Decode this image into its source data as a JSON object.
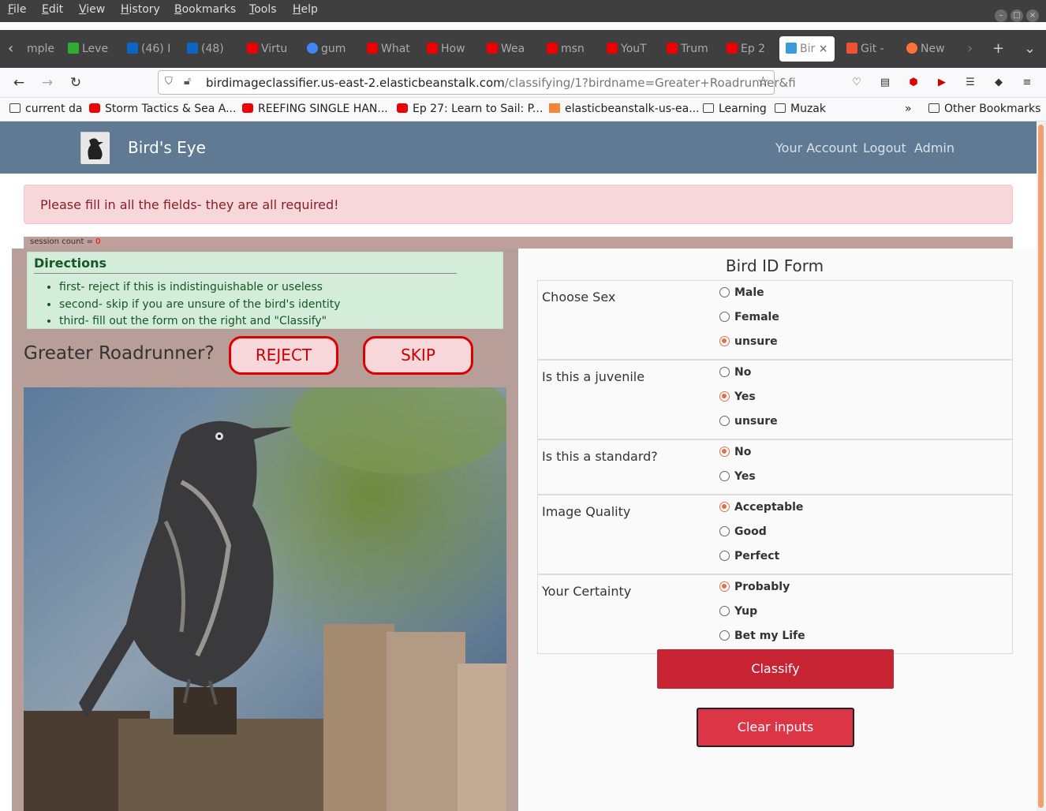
{
  "browser": {
    "menu": [
      "File",
      "Edit",
      "View",
      "History",
      "Bookmarks",
      "Tools",
      "Help"
    ],
    "tabs": [
      {
        "label": "mple",
        "icon": "none"
      },
      {
        "label": "Leve",
        "icon": "leaf-icon"
      },
      {
        "label": "(46) I",
        "icon": "linkedin-icon"
      },
      {
        "label": "(48)",
        "icon": "linkedin-icon"
      },
      {
        "label": "Virtu",
        "icon": "youtube-icon"
      },
      {
        "label": "gum",
        "icon": "google-icon"
      },
      {
        "label": "What",
        "icon": "youtube-icon"
      },
      {
        "label": "How",
        "icon": "youtube-icon"
      },
      {
        "label": "Wea",
        "icon": "youtube-icon"
      },
      {
        "label": "msn",
        "icon": "youtube-icon"
      },
      {
        "label": "YouT",
        "icon": "youtube-icon"
      },
      {
        "label": "Trum",
        "icon": "youtube-icon"
      },
      {
        "label": "Ep 2",
        "icon": "youtube-icon"
      },
      {
        "label": "Bir",
        "icon": "bird-icon",
        "active": true
      },
      {
        "label": "Git -",
        "icon": "git-icon"
      },
      {
        "label": "New",
        "icon": "firefox-icon"
      }
    ],
    "url": {
      "host": "birdimageclassifier.us-east-2.elasticbeanstalk.com",
      "path": "/classifying/1?birdname=Greater+Roadrunner&fi"
    },
    "bookmarks": [
      {
        "label": "current da",
        "icon": "folder"
      },
      {
        "label": "Storm Tactics & Sea A...",
        "icon": "yt"
      },
      {
        "label": "REEFING SINGLE HAN...",
        "icon": "yt"
      },
      {
        "label": "Ep 27: Learn to Sail: P...",
        "icon": "yt"
      },
      {
        "label": "elasticbeanstalk-us-ea...",
        "icon": "aws"
      },
      {
        "label": "Learning",
        "icon": "folder"
      },
      {
        "label": "Muzak",
        "icon": "folder"
      }
    ],
    "other_bookmarks": "Other Bookmarks"
  },
  "site": {
    "brand": "Bird's Eye",
    "nav": [
      "Your Account",
      "Logout",
      "Admin"
    ]
  },
  "alert": "Please fill in all the fields- they are all required!",
  "session": {
    "label": "session count = ",
    "count": "0"
  },
  "directions": {
    "title": "Directions",
    "items": [
      "first- reject if this is indistinguishable or useless",
      "second- skip if you are unsure of the bird's identity",
      "third- fill out the form on the right and \"Classify\""
    ]
  },
  "species_question": "Greater Roadrunner?",
  "buttons": {
    "reject": "REJECT",
    "skip": "SKIP",
    "classify": "Classify",
    "clear": "Clear inputs"
  },
  "form": {
    "title": "Bird ID Form",
    "fields": [
      {
        "label": "Choose Sex",
        "options": [
          "Male",
          "Female",
          "unsure"
        ],
        "selected": 2
      },
      {
        "label": "Is this a juvenile",
        "options": [
          "No",
          "Yes",
          "unsure"
        ],
        "selected": 1
      },
      {
        "label": "Is this a standard?",
        "options": [
          "No",
          "Yes"
        ],
        "selected": 0
      },
      {
        "label": "Image Quality",
        "options": [
          "Acceptable",
          "Good",
          "Perfect"
        ],
        "selected": 0
      },
      {
        "label": "Your Certainty",
        "options": [
          "Probably",
          "Yup",
          "Bet my Life"
        ],
        "selected": 0
      }
    ]
  },
  "colors": {
    "site_nav": "#5f7a92",
    "panel": "#b89e98",
    "accent_radio": "#e0704a",
    "primary_button": "#c82333"
  }
}
